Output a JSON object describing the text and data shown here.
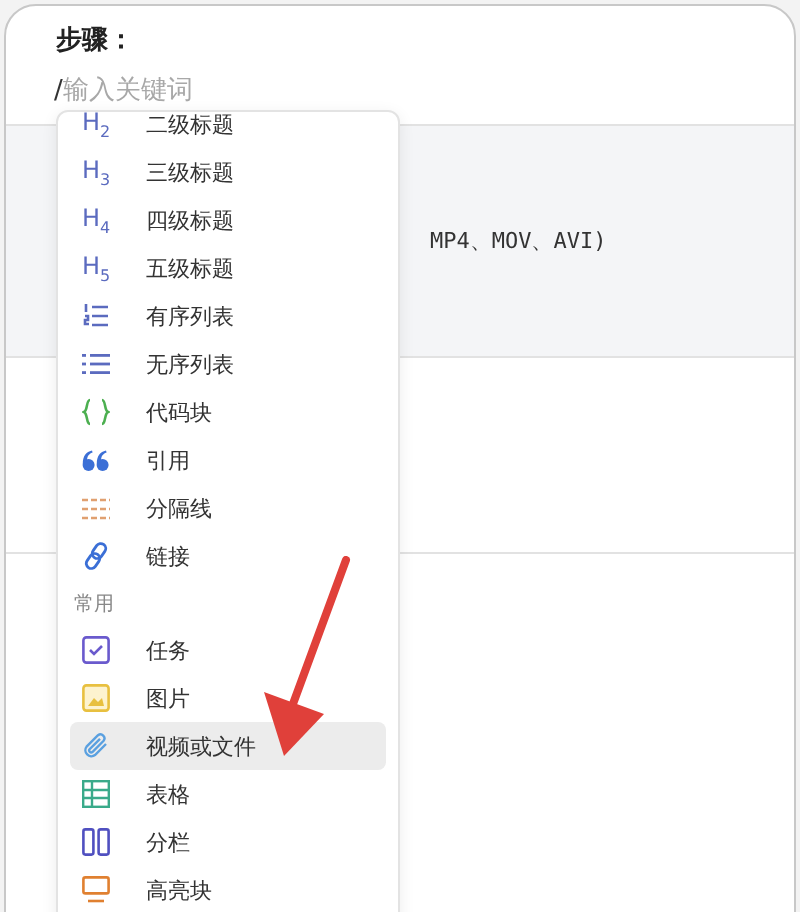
{
  "title": "步骤：",
  "input": {
    "value": "/",
    "placeholder": "输入关键词"
  },
  "code_block": {
    "text": "MP4、MOV、AVI)"
  },
  "menu": {
    "groups": [
      {
        "items": [
          {
            "kind": "h2",
            "icon_text": "H$_{2}$",
            "label": "二级标题",
            "selected": false
          },
          {
            "kind": "h3",
            "icon_text": "H$_{3}$",
            "label": "三级标题",
            "selected": false
          },
          {
            "kind": "h4",
            "icon_text": "H$_{4}$",
            "label": "四级标题",
            "selected": false
          },
          {
            "kind": "h5",
            "icon_text": "H$_{5}$",
            "label": "五级标题",
            "selected": false
          },
          {
            "kind": "ordered-list",
            "label": "有序列表",
            "selected": false
          },
          {
            "kind": "bullet-list",
            "label": "无序列表",
            "selected": false
          },
          {
            "kind": "code",
            "label": "代码块",
            "selected": false
          },
          {
            "kind": "quote",
            "label": "引用",
            "selected": false
          },
          {
            "kind": "divider",
            "label": "分隔线",
            "selected": false
          },
          {
            "kind": "link",
            "label": "链接",
            "selected": false
          }
        ]
      },
      {
        "header": "常用",
        "items": [
          {
            "kind": "task",
            "label": "任务",
            "selected": false
          },
          {
            "kind": "image",
            "label": "图片",
            "selected": false
          },
          {
            "kind": "attachment",
            "label": "视频或文件",
            "selected": true
          },
          {
            "kind": "table",
            "label": "表格",
            "selected": false
          },
          {
            "kind": "columns",
            "label": "分栏",
            "selected": false
          },
          {
            "kind": "highlight",
            "label": "高亮块",
            "selected": false
          }
        ]
      }
    ]
  }
}
